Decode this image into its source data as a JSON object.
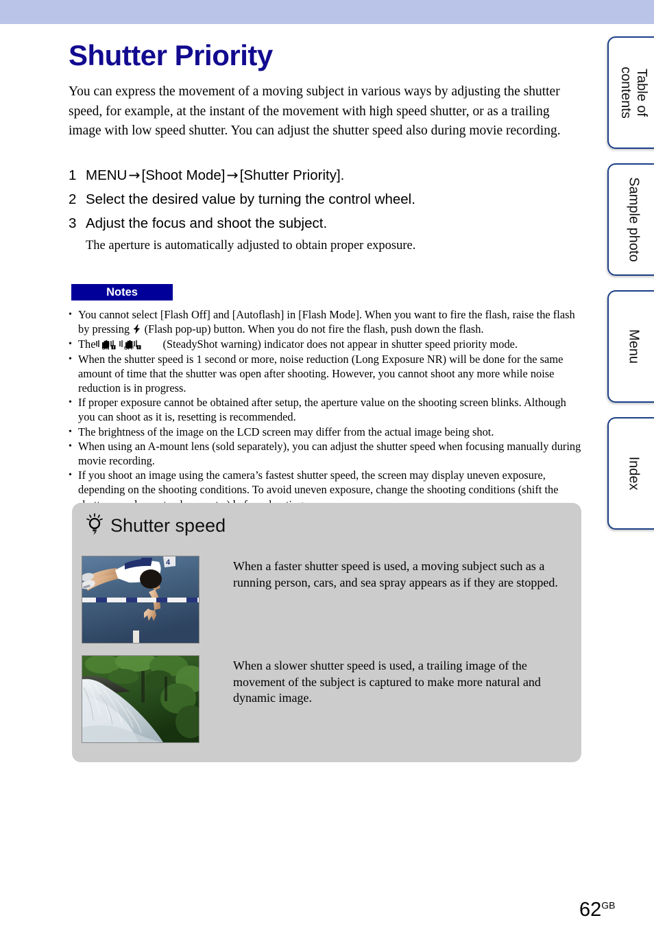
{
  "document": {
    "page_title": "Shutter Priority",
    "page_number": "62",
    "page_number_suffix": "GB",
    "title_color": "#120a8f",
    "band_color": "#b9c4e8"
  },
  "intro": {
    "paragraph": "You can express the movement of a moving subject in various ways by adjusting the shutter speed, for example, at the instant of the movement with high speed shutter, or as a trailing image with low speed shutter. You can adjust the shutter speed also during movie recording."
  },
  "steps": [
    {
      "number": "1",
      "part_1": "MENU",
      "arrow_1": "→",
      "part_2": "[Shoot Mode]",
      "arrow_2": "→",
      "part_3": "[Shutter Priority]."
    },
    {
      "number": "2",
      "text": "Select the desired value by turning the control wheel."
    },
    {
      "number": "3",
      "text": "Adjust the focus and shoot the subject.",
      "sub_text": "The aperture is automatically adjusted to obtain proper exposure."
    }
  ],
  "notes": {
    "banner_label": "Notes",
    "banner_bg": "#01019a",
    "bullet": "•",
    "items": [
      {
        "text_before": "You cannot select [Flash Off] and [Autoflash] in [Flash Mode]. When you want to fire the flash, raise the flash by pressing",
        "icon": "flash-pop-up-icon",
        "icon_glyph": "⚡",
        "text_after": "(Flash pop-up) button. When you do not fire the flash, push down the flash."
      },
      {
        "text_before": "The",
        "icon": "steadyshot-warning-icon",
        "icon_labels": [
          "ON",
          "OFF"
        ],
        "text_after": "(SteadyShot warning) indicator does not appear in shutter speed priority mode."
      },
      {
        "text": "When the shutter speed is 1 second or more, noise reduction (Long Exposure NR) will be done for the same amount of time that the shutter was open after shooting. However, you cannot shoot any more while noise reduction is in progress."
      },
      {
        "text": "If proper exposure cannot be obtained after setup, the aperture value on the shooting screen blinks. Although you can shoot as it is, resetting is recommended."
      },
      {
        "text": "The brightness of the image on the LCD screen may differ from the actual image being shot."
      },
      {
        "text": "When using an A-mount lens (sold separately), you can adjust the shutter speed when focusing manually during movie recording."
      },
      {
        "text": "If you shoot an image using the camera’s fastest shutter speed, the screen may display uneven exposure, depending on the shooting conditions. To avoid uneven exposure, change the shooting conditions (shift the shutter speed one step lower, etc.) before shooting."
      }
    ]
  },
  "tip_box": {
    "icon": "lightbulb-icon",
    "title": "Shutter speed",
    "background": "#cccccc",
    "rows": [
      {
        "image_alt": "high-jump-athlete-photo",
        "text": "When a faster shutter speed is used, a moving subject such as a running person, cars, and sea spray appears as if they are stopped."
      },
      {
        "image_alt": "waterfall-long-exposure-photo",
        "text": "When a slower shutter speed is used, a trailing image of the movement of the subject is captured to make more natural and dynamic image."
      }
    ]
  },
  "side_tabs": [
    {
      "label": "Table of contents",
      "two_line": true
    },
    {
      "label": "Sample photo",
      "two_line": false
    },
    {
      "label": "Menu",
      "two_line": false
    },
    {
      "label": "Index",
      "two_line": false
    }
  ]
}
